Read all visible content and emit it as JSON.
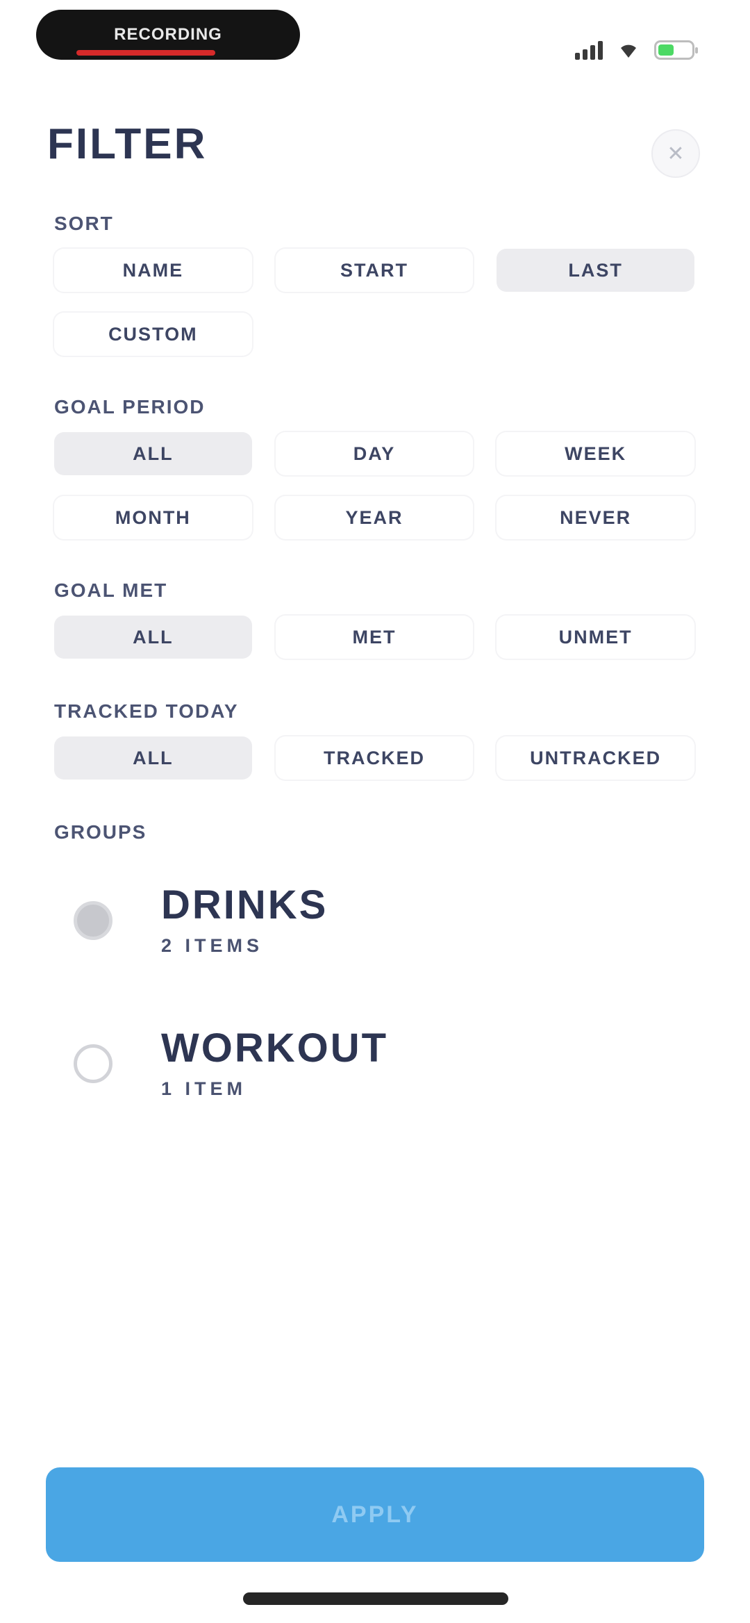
{
  "status_bar": {
    "pill_text": "RECORDING",
    "battery_color": "#4cd964",
    "icons": [
      "signal-icon",
      "wifi-icon",
      "battery-icon"
    ]
  },
  "header": {
    "title": "FILTER",
    "close_icon": "close-icon"
  },
  "sort": {
    "label": "SORT",
    "options": [
      "NAME",
      "START",
      "LAST",
      "CUSTOM"
    ],
    "selected": "LAST"
  },
  "goal_period": {
    "label": "GOAL PERIOD",
    "options": [
      "ALL",
      "DAY",
      "WEEK",
      "MONTH",
      "YEAR",
      "NEVER"
    ],
    "selected": "ALL"
  },
  "goal_met": {
    "label": "GOAL MET",
    "options": [
      "ALL",
      "MET",
      "UNMET"
    ],
    "selected": "ALL"
  },
  "tracked_today": {
    "label": "TRACKED TODAY",
    "options": [
      "ALL",
      "TRACKED",
      "UNTRACKED"
    ],
    "selected": "ALL"
  },
  "groups": {
    "label": "GROUPS",
    "items": [
      {
        "name": "DRINKS",
        "count": "2 ITEMS",
        "checked": true
      },
      {
        "name": "WORKOUT",
        "count": "1 ITEM",
        "checked": false
      }
    ]
  },
  "apply": {
    "label": "APPLY",
    "color": "#4aa6e4"
  }
}
